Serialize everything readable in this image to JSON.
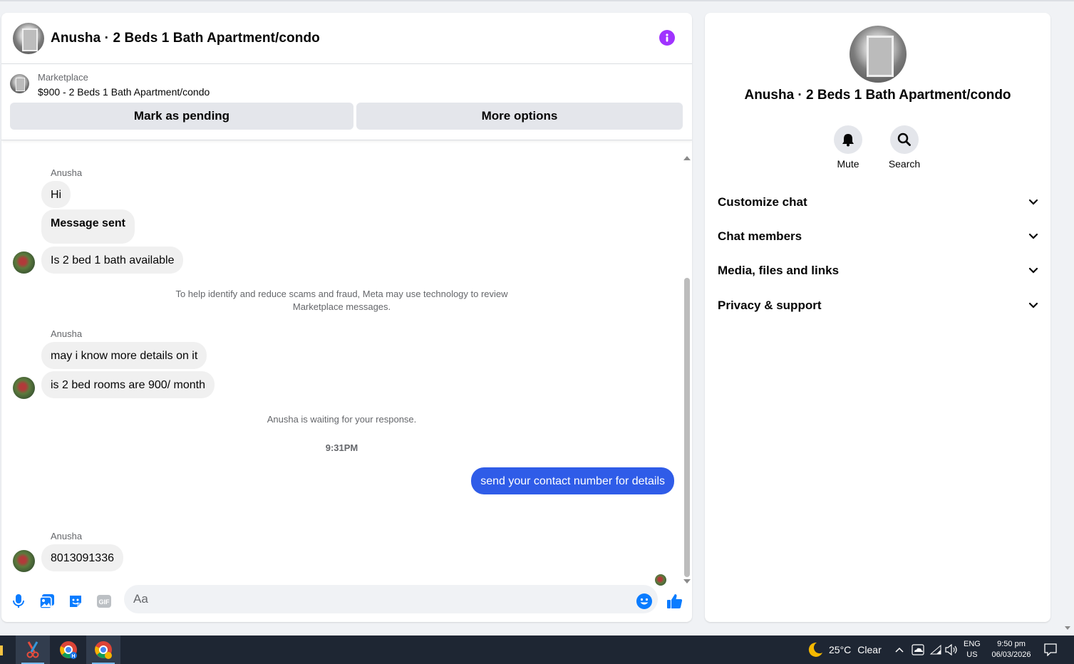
{
  "chat": {
    "title": "Anusha · 2 Beds 1 Bath Apartment/condo",
    "listing": {
      "label": "Marketplace",
      "price_title": "$900 - 2 Beds 1 Bath Apartment/condo",
      "pending_button": "Mark as pending",
      "more_button": "More options"
    },
    "messages": {
      "sender1": "Anusha",
      "m1": "Hi",
      "m2": "Message sent",
      "m3": "Is 2 bed 1 bath available",
      "notice_line1": "To help identify and reduce scams and fraud, Meta may use technology to review",
      "notice_line2": "Marketplace messages.",
      "sender2": "Anusha",
      "m4": "may i know more details on it",
      "m5": "is 2 bed rooms are 900/ month",
      "waiting": "Anusha is waiting for your response.",
      "time": "9:31PM",
      "out1": "send your contact number for details",
      "sender3": "Anusha",
      "m6": "8013091336"
    },
    "composer": {
      "placeholder": "Aa"
    }
  },
  "info_panel": {
    "title": "Anusha · 2 Beds 1 Bath Apartment/condo",
    "actions": [
      "Mute",
      "Search"
    ],
    "sections": [
      "Customize chat",
      "Chat members",
      "Media, files and links",
      "Privacy & support"
    ]
  },
  "taskbar": {
    "weather_temp": "25°C",
    "weather_text": "Clear",
    "lang_top": "ENG",
    "lang_bottom": "US",
    "clock_time": "9:50 pm",
    "clock_date": "06/03/2026"
  },
  "colors": {
    "accent_blue": "#2f5ce8",
    "info_purple": "#a033ff",
    "icon_blue": "#0a7cff"
  },
  "icons": [
    "info-icon",
    "microphone-icon",
    "photo-icon",
    "sticker-icon",
    "gif-icon",
    "emoji-icon",
    "thumbs-up-icon",
    "bell-icon",
    "search-icon",
    "chevron-down-icon",
    "moon-icon",
    "chevron-up-icon",
    "onedrive-icon",
    "wifi-icon",
    "volume-icon",
    "notification-icon"
  ]
}
